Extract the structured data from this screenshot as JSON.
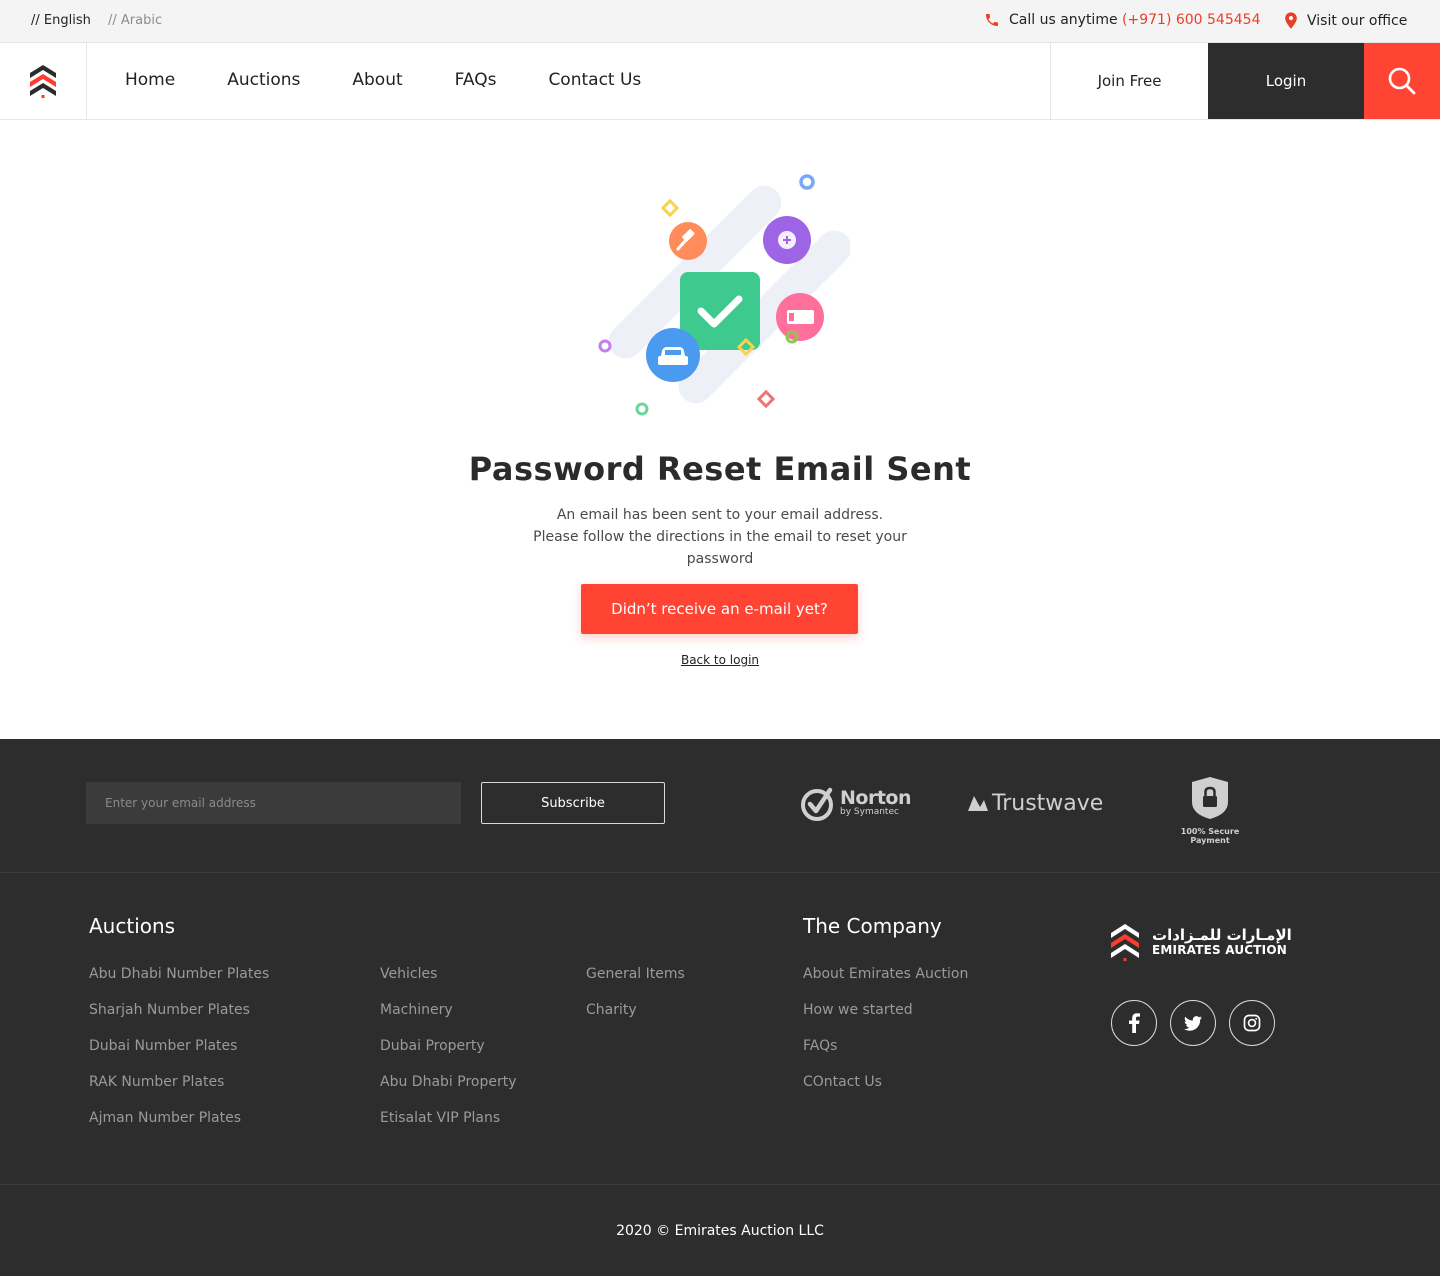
{
  "topbar": {
    "lang_english": "// English",
    "lang_arabic": "// Arabic",
    "call_label": "Call us anytime",
    "phone": "(+971) 600 545454",
    "office_label": "Visit our office"
  },
  "nav": {
    "items": [
      "Home",
      "Auctions",
      "About",
      "FAQs",
      "Contact Us"
    ],
    "join_label": "Join Free",
    "login_label": "Login"
  },
  "main": {
    "title": "Password Reset Email Sent",
    "message_line1": "An email has been sent to your email address.",
    "message_line2": "Please follow the directions in the email to reset your password",
    "resend_label": "Didn’t receive an e-mail yet?",
    "back_label": "Back to login"
  },
  "footer": {
    "email_placeholder": "Enter your email address",
    "subscribe_label": "Subscribe",
    "norton_main": "Norton",
    "norton_sub": "by Symantec",
    "trustwave": "Trustwave",
    "secure_payment": "100% Secure Payment",
    "auctions_title": "Auctions",
    "auctions_col1": [
      "Abu Dhabi Number Plates",
      "Sharjah Number Plates",
      "Dubai Number Plates",
      "RAK Number Plates",
      "Ajman Number Plates"
    ],
    "auctions_col2": [
      "Vehicles",
      "Machinery",
      "Dubai Property",
      "Abu Dhabi Property",
      "Etisalat VIP Plans"
    ],
    "auctions_col3": [
      "General Items",
      "Charity"
    ],
    "company_title": "The Company",
    "company_links": [
      "About Emirates Auction",
      "How we started",
      "FAQs",
      "COntact Us"
    ],
    "brand_arabic": "الإمـارات للمـزادات",
    "brand_english": "EMIRATES AUCTION",
    "social_icons": [
      "facebook-icon",
      "twitter-icon",
      "instagram-icon"
    ],
    "copyright": "2020 © Emirates Auction LLC"
  },
  "colors": {
    "accent": "#ff4433",
    "dark": "#2d2d2d",
    "phone": "#e6402a"
  }
}
